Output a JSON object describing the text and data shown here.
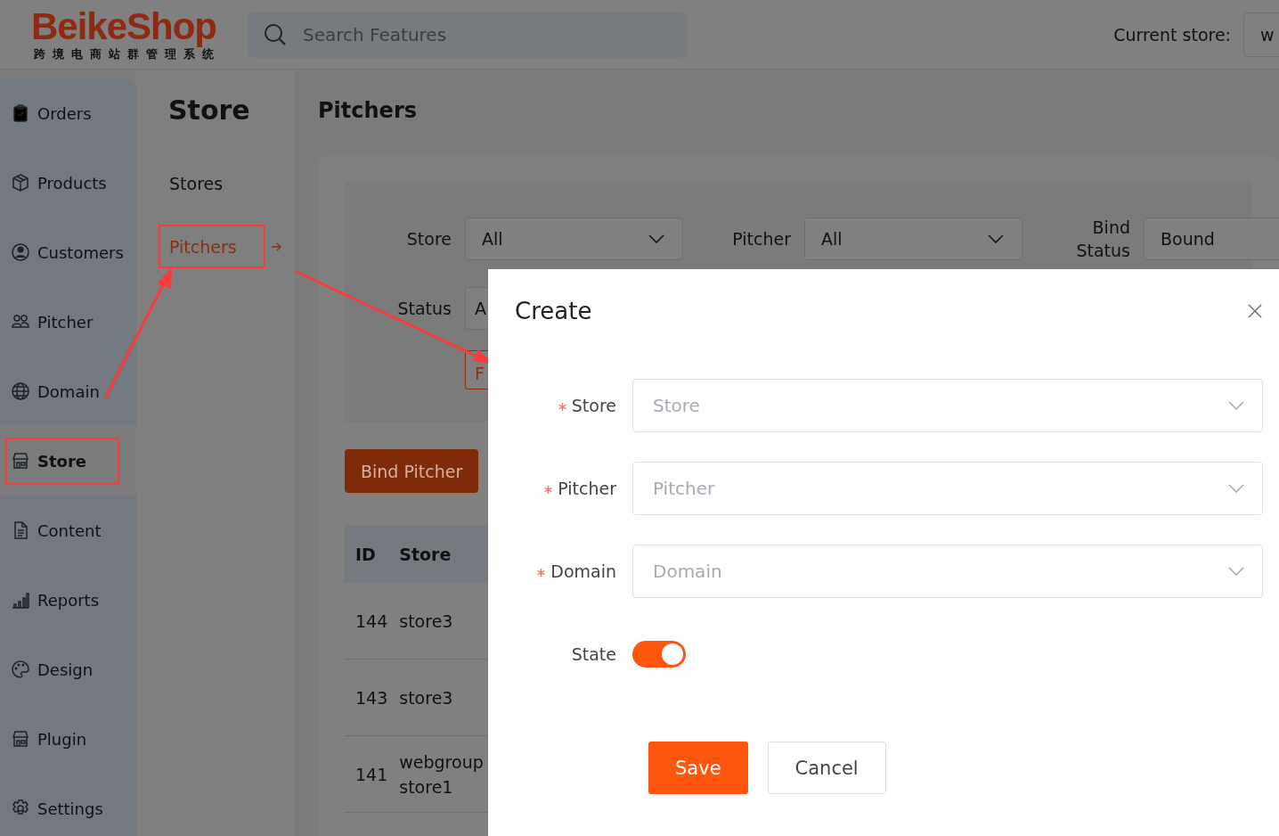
{
  "header": {
    "logo": "BeikeShop",
    "logo_subtitle": "跨境电商站群管理系统",
    "search": {
      "placeholder": "Search Features"
    },
    "current_store_label": "Current store:",
    "current_store_value": "w"
  },
  "sidebar": {
    "items": [
      {
        "label": "Orders",
        "selected": false,
        "highlighted": false
      },
      {
        "label": "Products",
        "selected": false,
        "highlighted": false
      },
      {
        "label": "Customers",
        "selected": false,
        "highlighted": false
      },
      {
        "label": "Pitcher",
        "selected": false,
        "highlighted": false
      },
      {
        "label": "Domain",
        "selected": false,
        "highlighted": false
      },
      {
        "label": "Store",
        "selected": true,
        "highlighted": true
      },
      {
        "label": "Content",
        "selected": false,
        "highlighted": false
      },
      {
        "label": "Reports",
        "selected": false,
        "highlighted": false
      },
      {
        "label": "Design",
        "selected": false,
        "highlighted": false
      },
      {
        "label": "Plugin",
        "selected": false,
        "highlighted": false
      },
      {
        "label": "Settings",
        "selected": false,
        "highlighted": false
      }
    ]
  },
  "submenu": {
    "title": "Store",
    "items": [
      {
        "label": "Stores",
        "selected": false,
        "highlighted": false
      },
      {
        "label": "Pitchers",
        "selected": true,
        "highlighted": true
      }
    ]
  },
  "page": {
    "title": "Pitchers",
    "filters": [
      {
        "label": "Store",
        "value": "All"
      },
      {
        "label": "Pitcher",
        "value": "All"
      },
      {
        "label": "Bind Status",
        "value": "Bound"
      },
      {
        "label": "Status",
        "value": "A"
      }
    ],
    "filter_button": "F",
    "bind_button": "Bind Pitcher",
    "table": {
      "columns": [
        "ID",
        "Store"
      ],
      "rows": [
        [
          "144",
          "store3"
        ],
        [
          "143",
          "store3"
        ],
        [
          "141",
          "webgroup store1"
        ]
      ]
    }
  },
  "dialog": {
    "title": "Create",
    "fields": [
      {
        "kind": "select",
        "label": "Store",
        "required": true,
        "placeholder": "Store"
      },
      {
        "kind": "select",
        "label": "Pitcher",
        "required": true,
        "placeholder": "Pitcher"
      },
      {
        "kind": "select",
        "label": "Domain",
        "required": true,
        "placeholder": "Domain"
      },
      {
        "kind": "switch",
        "label": "State",
        "required": false,
        "on": true
      }
    ],
    "buttons": [
      {
        "label": "Save",
        "kind": "primary"
      },
      {
        "label": "Cancel",
        "kind": "default"
      }
    ]
  }
}
